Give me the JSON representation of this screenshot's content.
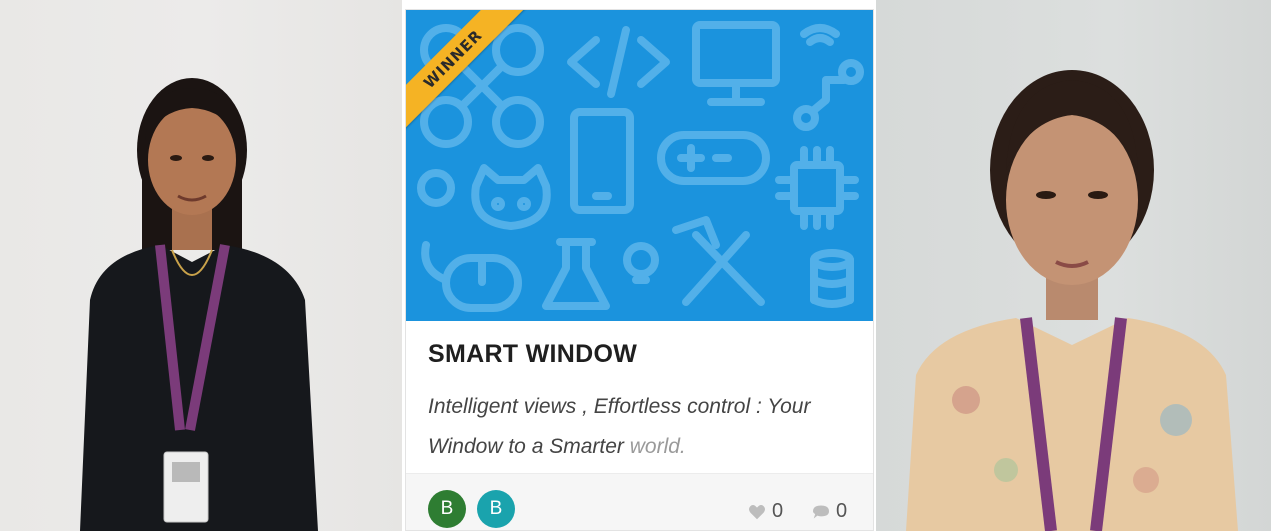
{
  "card": {
    "badge": "WINNER",
    "title": "SMART WINDOW",
    "description_main": "Intelligent views , Effortless control : Your Window to a Smarter",
    "description_faded": "world.",
    "avatars": [
      {
        "initial": "B",
        "color": "#2e7d32"
      },
      {
        "initial": "B",
        "color": "#1aa3ad"
      }
    ],
    "likes": "0",
    "comments": "0",
    "cover_color": "#1b93dd",
    "badge_color": "#f5b324",
    "cover_icons": [
      "drone-icon",
      "code-icon",
      "monitor-icon",
      "wifi-icon",
      "circuit-icon",
      "smartphone-icon",
      "gamepad-icon",
      "dollar-icon",
      "github-icon",
      "chip-icon",
      "mouse-icon",
      "flask-icon",
      "lightbulb-icon",
      "tools-icon",
      "database-icon"
    ]
  },
  "photos": {
    "left": "person-photo-left",
    "right": "person-photo-right"
  }
}
